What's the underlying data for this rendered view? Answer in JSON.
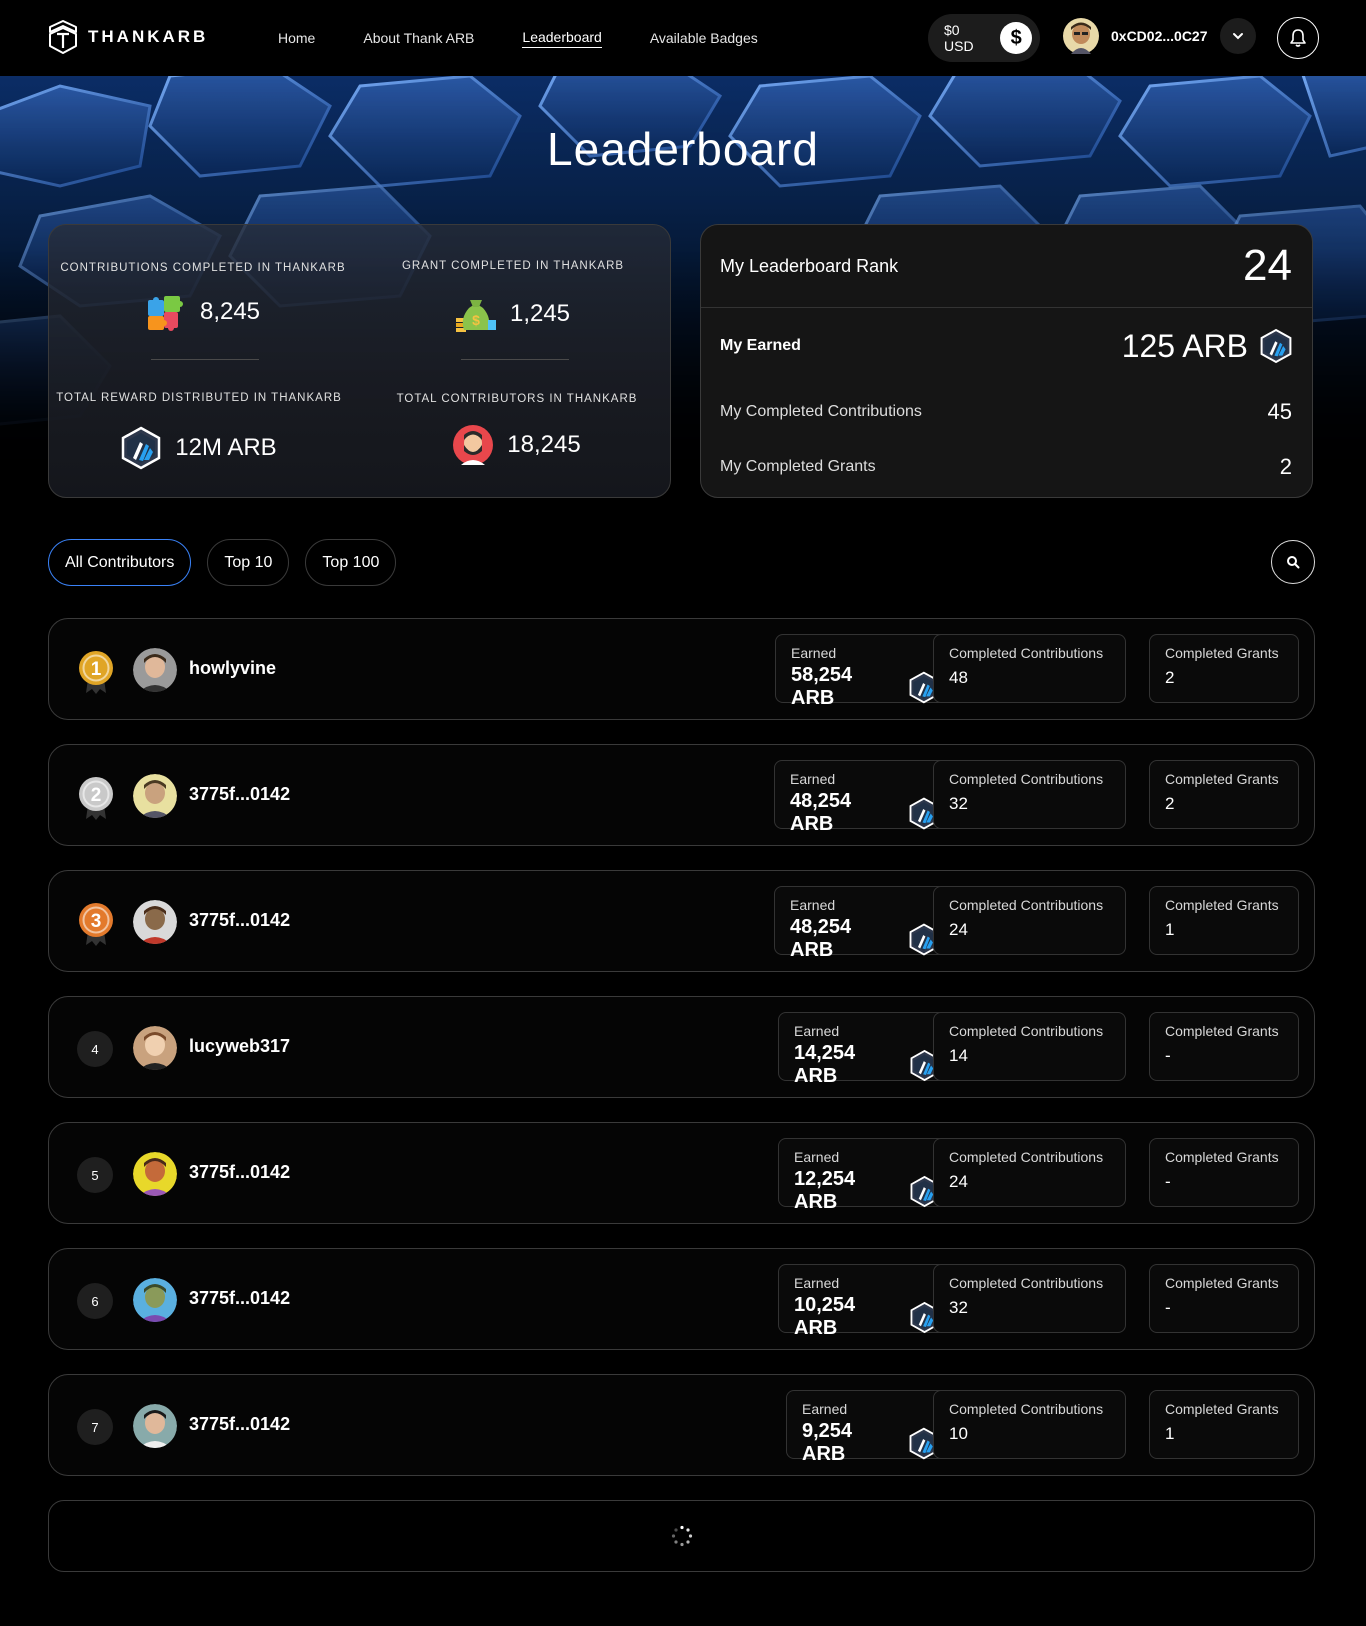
{
  "nav": {
    "brand": "THANKARB",
    "links": [
      "Home",
      "About Thank ARB",
      "Leaderboard",
      "Available Badges"
    ],
    "balance": "$0 USD",
    "wallet": "0xCD02...0C27"
  },
  "hero": {
    "title": "Leaderboard"
  },
  "stats": {
    "contributions_label": "CONTRIBUTIONS COMPLETED IN THANKARB",
    "contributions_value": "8,245",
    "grants_label": "GRANT COMPLETED IN THANKARB",
    "grants_value": "1,245",
    "reward_label": "TOTAL REWARD DISTRIBUTED IN THANKARB",
    "reward_value": "12M ARB",
    "contributors_label": "TOTAL CONTRIBUTORS IN THANKARB",
    "contributors_value": "18,245"
  },
  "my_rank": {
    "title": "My Leaderboard Rank",
    "rank": "24",
    "earned_label": "My Earned",
    "earned_value": "125 ARB",
    "contrib_label": "My Completed Contributions",
    "contrib_value": "45",
    "grants_label": "My Completed Grants",
    "grants_value": "2"
  },
  "filters": [
    "All Contributors",
    "Top 10",
    "Top 100"
  ],
  "labels": {
    "earned": "Earned",
    "contributions": "Completed Contributions",
    "grants": "Completed Grants"
  },
  "rows": [
    {
      "rank": "1",
      "name": "howlyvine",
      "earned": "58,254 ARB",
      "contributions": "48",
      "grants": "2"
    },
    {
      "rank": "2",
      "name": "3775f...0142",
      "earned": "48,254 ARB",
      "contributions": "32",
      "grants": "2"
    },
    {
      "rank": "3",
      "name": "3775f...0142",
      "earned": "48,254 ARB",
      "contributions": "24",
      "grants": "1"
    },
    {
      "rank": "4",
      "name": "lucyweb317",
      "earned": "14,254 ARB",
      "contributions": "14",
      "grants": "-"
    },
    {
      "rank": "5",
      "name": "3775f...0142",
      "earned": "12,254 ARB",
      "contributions": "24",
      "grants": "-"
    },
    {
      "rank": "6",
      "name": "3775f...0142",
      "earned": "10,254 ARB",
      "contributions": "32",
      "grants": "-"
    },
    {
      "rank": "7",
      "name": "3775f...0142",
      "earned": "9,254 ARB",
      "contributions": "10",
      "grants": "1"
    }
  ],
  "colors": {
    "accent": "#3a82f7",
    "gold": "#e0a526",
    "silver": "#c9c9c9",
    "bronze": "#e37a2c"
  }
}
